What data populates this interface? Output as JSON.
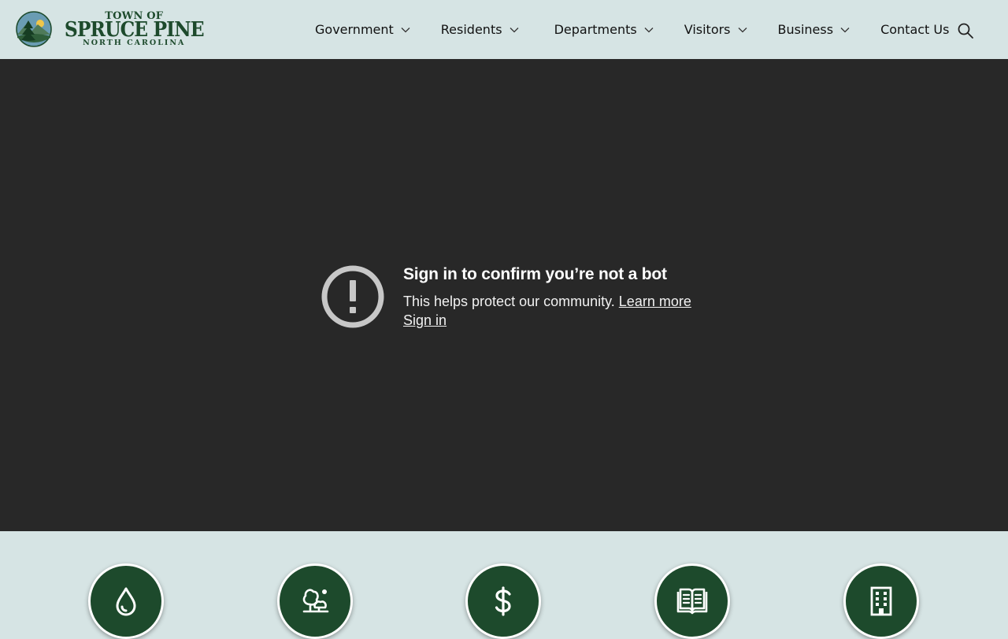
{
  "header": {
    "logo": {
      "line1": "TOWN OF",
      "line2": "SPRUCE PINE",
      "line3": "NORTH CAROLINA"
    },
    "nav": [
      {
        "label": "Government",
        "has_dropdown": true
      },
      {
        "label": "Residents",
        "has_dropdown": true
      },
      {
        "label": "Departments",
        "has_dropdown": true
      },
      {
        "label": "Visitors",
        "has_dropdown": true
      },
      {
        "label": "Business",
        "has_dropdown": true
      },
      {
        "label": "Contact Us",
        "has_dropdown": false
      }
    ],
    "search_icon": "search-icon"
  },
  "video": {
    "title": "Sign in to confirm you’re not a bot",
    "description": "This helps protect our community.",
    "learn_more": "Learn more",
    "sign_in": "Sign in",
    "icon": "alert-circle-icon"
  },
  "quick_links": [
    {
      "icon": "water-drop-icon"
    },
    {
      "icon": "trees-icon"
    },
    {
      "icon": "dollar-icon"
    },
    {
      "icon": "open-book-icon"
    },
    {
      "icon": "building-icon"
    }
  ],
  "colors": {
    "header_bg": "#d6e4e4",
    "brand_green": "#1d4a2c",
    "video_bg": "#282828",
    "text_dark": "#111111"
  }
}
